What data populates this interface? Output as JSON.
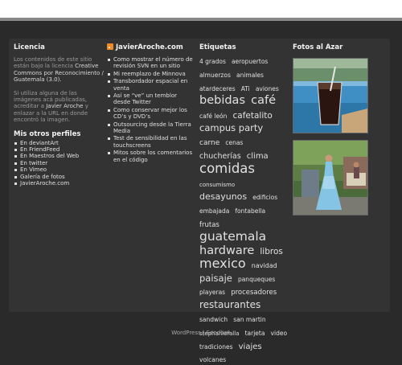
{
  "licencia": {
    "title": "Licencia",
    "text_pre": "Los contenidos de este sitio están bajo la licencia",
    "text_link": "Creative Commons por Reconocimiento / Guatemala (3.0).",
    "text2_pre": "Si utiliza alguna de las imágenes acá publicadas, acreditar a",
    "text2_link": "Javier Aroche",
    "text2_post": "y enlazar a la URL en donde encontró la imagen."
  },
  "perfiles": {
    "title": "Mis otros perfiles",
    "items": [
      "En deviantArt",
      "En FriendFeed",
      "En Maestros del Web",
      "En twitter",
      "En Vimeo",
      "Galería de fotos",
      "JavierAroche.com"
    ]
  },
  "blog": {
    "title": "JavierAroche.com",
    "icon": "rss-icon",
    "posts": [
      "Como mostrar el número de revisión SVN en un sitio",
      "Mi reemplazo de Minnova",
      "Transbordador espacial en venta",
      "Así se “ve” un temblor desde Twitter",
      "Como conservar mejor los CD’s y DVD’s",
      "Outsourcing desde la Tierra Media",
      "Test de sensibilidad en las touchscreens",
      "Mitos sobre los comentarios en el código"
    ]
  },
  "etiquetas": {
    "title": "Etiquetas",
    "tags": [
      {
        "label": "4 grados",
        "size": 7.5
      },
      {
        "label": "aeropuertos",
        "size": 7.5
      },
      {
        "label": "almuerzos",
        "size": 7.5
      },
      {
        "label": "animales",
        "size": 7.5
      },
      {
        "label": "atardeceres",
        "size": 7.5
      },
      {
        "label": "ATi",
        "size": 7.5
      },
      {
        "label": "aviones",
        "size": 7.5
      },
      {
        "label": "bebidas",
        "size": 14.5
      },
      {
        "label": "café",
        "size": 14.5
      },
      {
        "label": "café león",
        "size": 7.5
      },
      {
        "label": "cafetalito",
        "size": 10.5
      },
      {
        "label": "campus party",
        "size": 11.5
      },
      {
        "label": "carne",
        "size": 9
      },
      {
        "label": "cenas",
        "size": 7.5
      },
      {
        "label": "chucherías",
        "size": 9.5
      },
      {
        "label": "clima",
        "size": 10
      },
      {
        "label": "comidas",
        "size": 16.5
      },
      {
        "label": "consumismo",
        "size": 7
      },
      {
        "label": "desayunos",
        "size": 11
      },
      {
        "label": "edificios",
        "size": 7.5
      },
      {
        "label": "embajada",
        "size": 7.5
      },
      {
        "label": "fontabella",
        "size": 7.5
      },
      {
        "label": "frutas",
        "size": 8.5
      },
      {
        "label": "guatemala",
        "size": 15.5
      },
      {
        "label": "hardware",
        "size": 14.5
      },
      {
        "label": "libros",
        "size": 10.5
      },
      {
        "label": "mexico",
        "size": 16
      },
      {
        "label": "navidad",
        "size": 8
      },
      {
        "label": "paisaje",
        "size": 11.5
      },
      {
        "label": "panqueques",
        "size": 7.5
      },
      {
        "label": "playeras",
        "size": 7.5
      },
      {
        "label": "procesadores",
        "size": 8.5
      },
      {
        "label": "restaurantes",
        "size": 12
      },
      {
        "label": "sandwich",
        "size": 7.5
      },
      {
        "label": "san martin",
        "size": 7.5
      },
      {
        "label": "stephaniefalla",
        "size": 7
      },
      {
        "label": "tarjeta",
        "size": 7.5
      },
      {
        "label": "video",
        "size": 7.5
      },
      {
        "label": "tradiciones",
        "size": 7.5
      },
      {
        "label": "viajes",
        "size": 10
      },
      {
        "label": "volcanes",
        "size": 7.5
      }
    ]
  },
  "fotos": {
    "title": "Fotos al Azar",
    "photos": [
      "iced-drink-by-pool-photo",
      "girl-in-blue-dress-photo"
    ]
  },
  "footer": {
    "wordpress": "WordPress",
    "separator": "|",
    "sandbox": "Sandbox"
  }
}
